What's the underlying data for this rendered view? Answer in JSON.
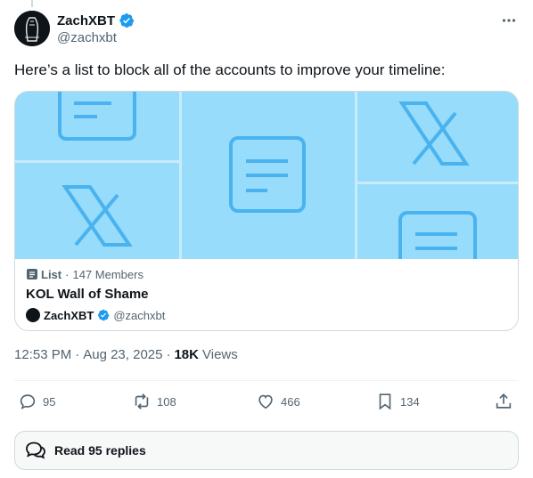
{
  "author": {
    "display_name": "ZachXBT",
    "handle": "@zachxbt",
    "verified": true,
    "verified_color": "#1d9bf0"
  },
  "tweet": {
    "text": "Here’s a list to block all of the accounts to improve your timeline:"
  },
  "card": {
    "list_kind": "List",
    "members": "147 Members",
    "title": "KOL Wall of Shame",
    "owner_name": "ZachXBT",
    "owner_handle": "@zachxbt",
    "banner_color": "#97dcfb",
    "banner_icon_color": "#4ab3ef"
  },
  "meta": {
    "time": "12:53 PM",
    "date": "Aug 23, 2025",
    "views_count": "18K",
    "views_label": "Views"
  },
  "actions": {
    "replies": "95",
    "reposts": "108",
    "likes": "466",
    "bookmarks": "134"
  },
  "footer": {
    "read_replies_label": "Read 95 replies"
  },
  "icons": [
    "more-icon",
    "verified-icon",
    "list-icon",
    "reply-icon",
    "repost-icon",
    "like-icon",
    "bookmark-icon",
    "share-icon",
    "chat-bubbles-icon"
  ]
}
